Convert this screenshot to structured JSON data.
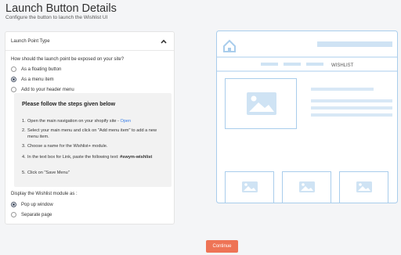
{
  "page": {
    "title": "Launch Button Details",
    "subtitle": "Configure the button to launch the Wishlist UI"
  },
  "launch_panel": {
    "header": "Launch Point Type",
    "question": "How should the launch point be exposed on your site?",
    "options": [
      {
        "label": "As a floating button",
        "checked": false
      },
      {
        "label": "As a menu item",
        "checked": true
      },
      {
        "label": "Add to your header menu",
        "checked": false
      }
    ]
  },
  "steps": {
    "title": "Please follow the steps given below",
    "items": [
      {
        "num": "1.",
        "text": "Open the main navigation on your shopify site - ",
        "link": "Open"
      },
      {
        "num": "2.",
        "text": "Select your main menu and click on \"Add menu item\" to add a new menu item."
      },
      {
        "num": "3.",
        "text": "Choose a name for the Wishlist+ module."
      },
      {
        "num": "4.",
        "text": "In the text box for Link, paste the following text: ",
        "code": "#swym-wishlist"
      },
      {
        "num": "5.",
        "text": "Click on \"Save Menu\""
      }
    ]
  },
  "display": {
    "question": "Display the Wishlist module as :",
    "options": [
      {
        "label": "Pop up window",
        "checked": true
      },
      {
        "label": "Separate page",
        "checked": false
      }
    ]
  },
  "preview": {
    "nav_label": "WISHLIST",
    "accent_color": "#a9cdec"
  },
  "footer": {
    "continue_label": "Continue",
    "button_color": "#ee7456"
  }
}
